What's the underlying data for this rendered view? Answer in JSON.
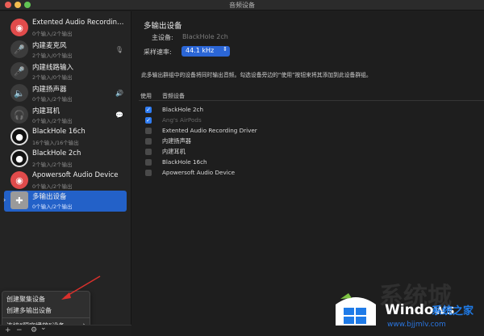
{
  "window": {
    "title": "音频设备"
  },
  "sidebar": {
    "devices": [
      {
        "name": "Extented Audio Recording…",
        "sub": "0个输入/2个输出",
        "icon": "audio-recorder-icon",
        "color": "#e04b4b",
        "side": ""
      },
      {
        "name": "内建麦克风",
        "sub": "2个输入/0个输出",
        "icon": "microphone-icon",
        "color": "#4a4a4a",
        "side": "🎙"
      },
      {
        "name": "内建线路输入",
        "sub": "2个输入/0个输出",
        "icon": "line-in-icon",
        "color": "#4a4a4a",
        "side": ""
      },
      {
        "name": "内建扬声器",
        "sub": "0个输入/2个输出",
        "icon": "speaker-icon",
        "color": "#4a4a4a",
        "side": "🔊"
      },
      {
        "name": "内建耳机",
        "sub": "0个输入/2个输出",
        "icon": "headphones-icon",
        "color": "#4a4a4a",
        "side": "💬"
      },
      {
        "name": "BlackHole 16ch",
        "sub": "16个输入/16个输出",
        "icon": "blackhole-icon",
        "color": "#1a1a1a",
        "side": ""
      },
      {
        "name": "BlackHole 2ch",
        "sub": "2个输入/2个输出",
        "icon": "blackhole-icon",
        "color": "#1a1a1a",
        "side": ""
      },
      {
        "name": "Apowersoft Audio Device",
        "sub": "0个输入/2个输出",
        "icon": "apowersoft-icon",
        "color": "#e04b4b",
        "side": ""
      },
      {
        "name": "多输出设备",
        "sub": "0个输入/2个输出",
        "icon": "multi-output-icon",
        "color": "#8a8a8a",
        "side": "",
        "selected": true
      }
    ]
  },
  "context_menu": {
    "items": [
      "创建聚集设备",
      "创建多输出设备"
    ],
    "connect_label": "连接“隔空播放”设备",
    "arrow": "›"
  },
  "toolbar": {
    "add": "+",
    "remove": "−",
    "gear": "⚙",
    "chevron": "⌄"
  },
  "main": {
    "title": "多输出设备",
    "master_label": "主设备:",
    "master_value": "BlackHole 2ch",
    "sample_rate_label": "采样速率:",
    "sample_rate_value": "44.1 kHz",
    "description": "此多输出群组中的设备将同时输出音频。勾选设备旁边的“使用”按钮来将其添加到此设备群组。",
    "col_use": "使用",
    "col_device": "音频设备",
    "rows": [
      {
        "name": "BlackHole 2ch",
        "checked": true,
        "disabled": false
      },
      {
        "name": "Ang's AirPods",
        "checked": true,
        "disabled": true
      },
      {
        "name": "Extented Audio Recording Driver",
        "checked": false,
        "disabled": false
      },
      {
        "name": "内建扬声器",
        "checked": false,
        "disabled": false
      },
      {
        "name": "内建耳机",
        "checked": false,
        "disabled": false
      },
      {
        "name": "BlackHole 16ch",
        "checked": false,
        "disabled": false
      },
      {
        "name": "Apowersoft Audio Device",
        "checked": false,
        "disabled": false
      }
    ]
  },
  "watermark": {
    "faint": "系统城",
    "brand": "Windows",
    "brand_cn": "系统之家",
    "url": "www.bjjmlv.com"
  },
  "colors": {
    "accent": "#2361c8",
    "select_bg": "#2b66d6",
    "checkbox_on": "#2f7cf2",
    "annotation_arrow": "#d9302c"
  }
}
